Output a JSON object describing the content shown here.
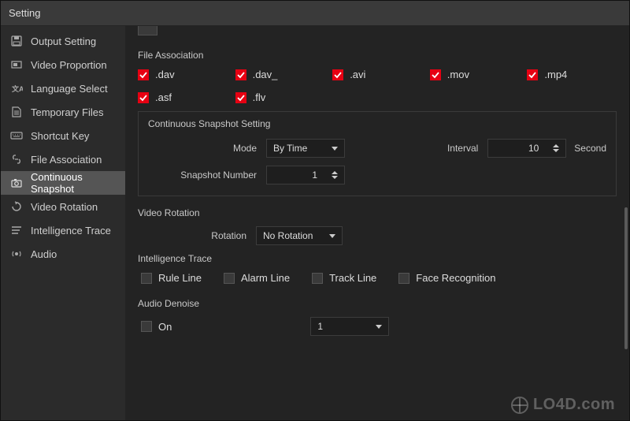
{
  "window": {
    "title": "Setting",
    "close_label": "×"
  },
  "sidebar": {
    "items": [
      {
        "label": "Output Setting"
      },
      {
        "label": "Video Proportion"
      },
      {
        "label": "Language Select"
      },
      {
        "label": "Temporary Files"
      },
      {
        "label": "Shortcut Key"
      },
      {
        "label": "File Association"
      },
      {
        "label": "Continuous Snapshot"
      },
      {
        "label": "Video Rotation"
      },
      {
        "label": "Intelligence Trace"
      },
      {
        "label": "Audio"
      }
    ]
  },
  "file_association": {
    "title": "File Association",
    "items": [
      {
        "ext": ".dav",
        "checked": true
      },
      {
        "ext": ".dav_",
        "checked": true
      },
      {
        "ext": ".avi",
        "checked": true
      },
      {
        "ext": ".mov",
        "checked": true
      },
      {
        "ext": ".mp4",
        "checked": true
      },
      {
        "ext": ".asf",
        "checked": true
      },
      {
        "ext": ".flv",
        "checked": true
      }
    ]
  },
  "continuous_snapshot": {
    "title": "Continuous Snapshot Setting",
    "mode_label": "Mode",
    "mode_value": "By Time",
    "interval_label": "Interval",
    "interval_value": "10",
    "interval_unit": "Second",
    "number_label": "Snapshot Number",
    "number_value": "1"
  },
  "video_rotation": {
    "title": "Video Rotation",
    "label": "Rotation",
    "value": "No Rotation"
  },
  "intelligence_trace": {
    "title": "Intelligence Trace",
    "options": [
      {
        "label": "Rule Line",
        "checked": false
      },
      {
        "label": "Alarm Line",
        "checked": false
      },
      {
        "label": "Track Line",
        "checked": false
      },
      {
        "label": "Face Recognition",
        "checked": false
      }
    ]
  },
  "audio_denoise": {
    "title": "Audio Denoise",
    "on_label": "On",
    "on_checked": false,
    "level_value": "1"
  },
  "watermark": "LO4D.com"
}
